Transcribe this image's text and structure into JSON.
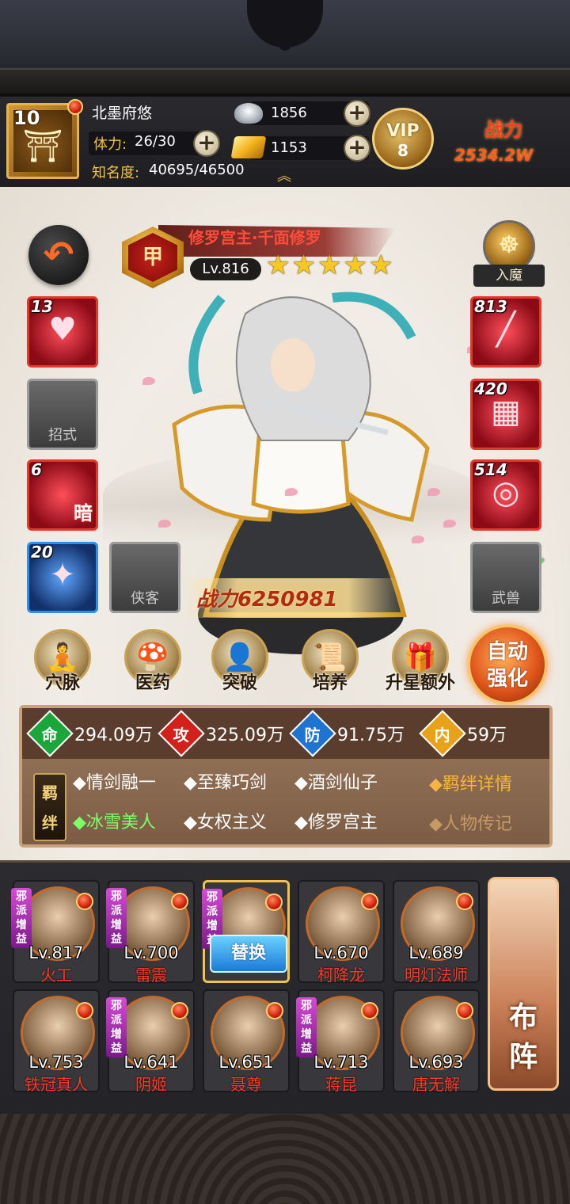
{
  "player": {
    "level": "10",
    "name": "北墨府悠",
    "stamina_label": "体力:",
    "stamina_value": "26/30",
    "fame_label": "知名度:",
    "fame_value": "40695/46500",
    "silver": "1856",
    "gold": "1153",
    "vip_text": "VIP",
    "vip_level": "8",
    "combat_label": "战力",
    "combat_value": "2534.2W"
  },
  "hero": {
    "title": "修罗宫主·千面修罗",
    "rank_seal": "甲",
    "level": "Lv.816",
    "stars": 5,
    "power": "战力6250981",
    "demon_label": "入魔"
  },
  "slots": {
    "left": [
      {
        "num": "13",
        "glyph": "♥",
        "label": ""
      },
      {
        "num": "",
        "glyph": "",
        "label": "招式"
      },
      {
        "num": "6",
        "glyph": "",
        "label": "",
        "corner": "暗"
      },
      {
        "num": "20",
        "glyph": "✦",
        "label": ""
      },
      {
        "num": "",
        "glyph": "",
        "label": "侠客"
      }
    ],
    "right": [
      {
        "num": "813",
        "glyph": "╱",
        "label": ""
      },
      {
        "num": "420",
        "glyph": "▦",
        "label": ""
      },
      {
        "num": "514",
        "glyph": "◎",
        "label": ""
      },
      {
        "num": "",
        "glyph": "",
        "label": "武兽"
      }
    ]
  },
  "actions": [
    {
      "label": "穴脉",
      "icon": "meridian-icon"
    },
    {
      "label": "医药",
      "icon": "medicine-icon"
    },
    {
      "label": "突破",
      "icon": "breakthrough-icon"
    },
    {
      "label": "培养",
      "icon": "cultivate-icon"
    },
    {
      "label": "升星额外",
      "icon": "star-up-icon"
    }
  ],
  "auto_button": "自动强化",
  "stats": [
    {
      "badge": "命",
      "value": "294.09万",
      "color": "#1aa63a"
    },
    {
      "badge": "攻",
      "value": "325.09万",
      "color": "#d2201a"
    },
    {
      "badge": "防",
      "value": "91.75万",
      "color": "#1f74d2"
    },
    {
      "badge": "内",
      "value": "59万",
      "color": "#e8a21a"
    }
  ],
  "bonds": {
    "seal": "羁绊",
    "items": [
      {
        "text": "◆情剑融一",
        "active": false
      },
      {
        "text": "◆至臻巧剑",
        "active": false
      },
      {
        "text": "◆酒剑仙子",
        "active": false
      },
      {
        "text": "◆冰雪美人",
        "active": true
      },
      {
        "text": "◆女权主义",
        "active": false
      },
      {
        "text": "◆修罗宫主",
        "active": false
      }
    ],
    "detail_link": "◆羁绊详情",
    "bio_link": "◆人物传记"
  },
  "team": [
    {
      "level": "Lv.817",
      "name": "火工",
      "evil": true
    },
    {
      "level": "Lv.700",
      "name": "雷震",
      "evil": true
    },
    {
      "level": "",
      "name": "",
      "evil": true,
      "selected": true
    },
    {
      "level": "Lv.670",
      "name": "柯降龙",
      "evil": false
    },
    {
      "level": "Lv.689",
      "name": "明灯法师",
      "evil": false
    },
    {
      "level": "Lv.753",
      "name": "铁冠真人",
      "evil": false
    },
    {
      "level": "Lv.641",
      "name": "阴姬",
      "evil": true
    },
    {
      "level": "Lv.651",
      "name": "聂尊",
      "evil": false
    },
    {
      "level": "Lv.713",
      "name": "蒋昆",
      "evil": true
    },
    {
      "level": "Lv.693",
      "name": "唐无解",
      "evil": false
    }
  ],
  "evil_tag": "邪派增益",
  "swap_label": "替换",
  "formation_label": "布阵"
}
